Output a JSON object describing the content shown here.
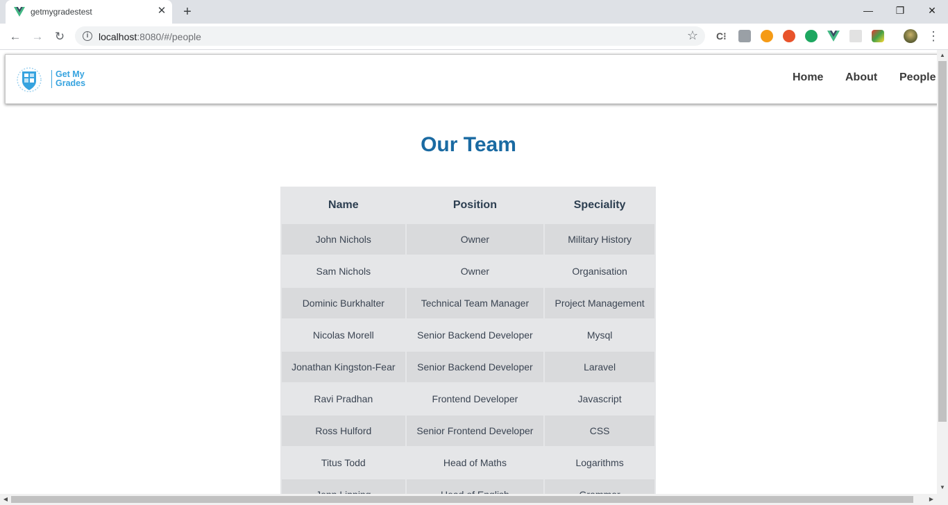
{
  "browser": {
    "tab_title": "getmygradestest",
    "tab_close": "✕",
    "new_tab": "+",
    "url_host": "localhost",
    "url_rest": ":8080/#/people",
    "window_minimize": "—",
    "window_restore": "❐",
    "window_close": "✕"
  },
  "site": {
    "logo_line1": "Get My",
    "logo_line2": "Grades",
    "nav": [
      "Home",
      "About",
      "People"
    ]
  },
  "page": {
    "title": "Our Team"
  },
  "table": {
    "headers": [
      "Name",
      "Position",
      "Speciality"
    ],
    "rows": [
      [
        "John Nichols",
        "Owner",
        "Military History"
      ],
      [
        "Sam Nichols",
        "Owner",
        "Organisation"
      ],
      [
        "Dominic Burkhalter",
        "Technical Team Manager",
        "Project Management"
      ],
      [
        "Nicolas Morell",
        "Senior Backend Developer",
        "Mysql"
      ],
      [
        "Jonathan Kingston-Fear",
        "Senior Backend Developer",
        "Laravel"
      ],
      [
        "Ravi Pradhan",
        "Frontend Developer",
        "Javascript"
      ],
      [
        "Ross Hulford",
        "Senior Frontend Developer",
        "CSS"
      ],
      [
        "Titus Todd",
        "Head of Maths",
        "Logarithms"
      ],
      [
        "Jenn Lipping",
        "Head of English",
        "Grammar"
      ]
    ]
  },
  "colors": {
    "title": "#1a6aa2",
    "logo": "#36a3df",
    "table_bg": "#e5e6e8",
    "table_alt": "#d9dadc"
  }
}
